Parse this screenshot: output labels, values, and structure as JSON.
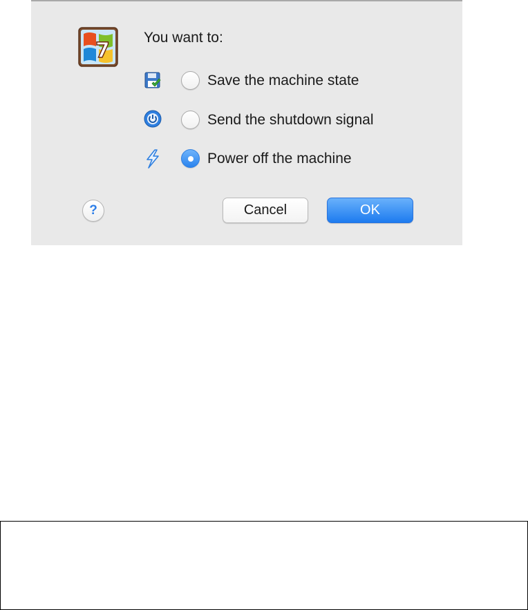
{
  "dialog": {
    "prompt": "You want to:",
    "os_logo_icon": "windows-7-logo-icon",
    "options": [
      {
        "icon": "save-state-icon",
        "label": "Save the machine state",
        "selected": false
      },
      {
        "icon": "acpi-shutdown-icon",
        "label": "Send the shutdown signal",
        "selected": false
      },
      {
        "icon": "power-off-icon",
        "label": "Power off the machine",
        "selected": true
      }
    ],
    "help_label": "?",
    "cancel_label": "Cancel",
    "ok_label": "OK"
  },
  "colors": {
    "dialog_bg": "#e9e9e9",
    "accent": "#2a83ee"
  }
}
